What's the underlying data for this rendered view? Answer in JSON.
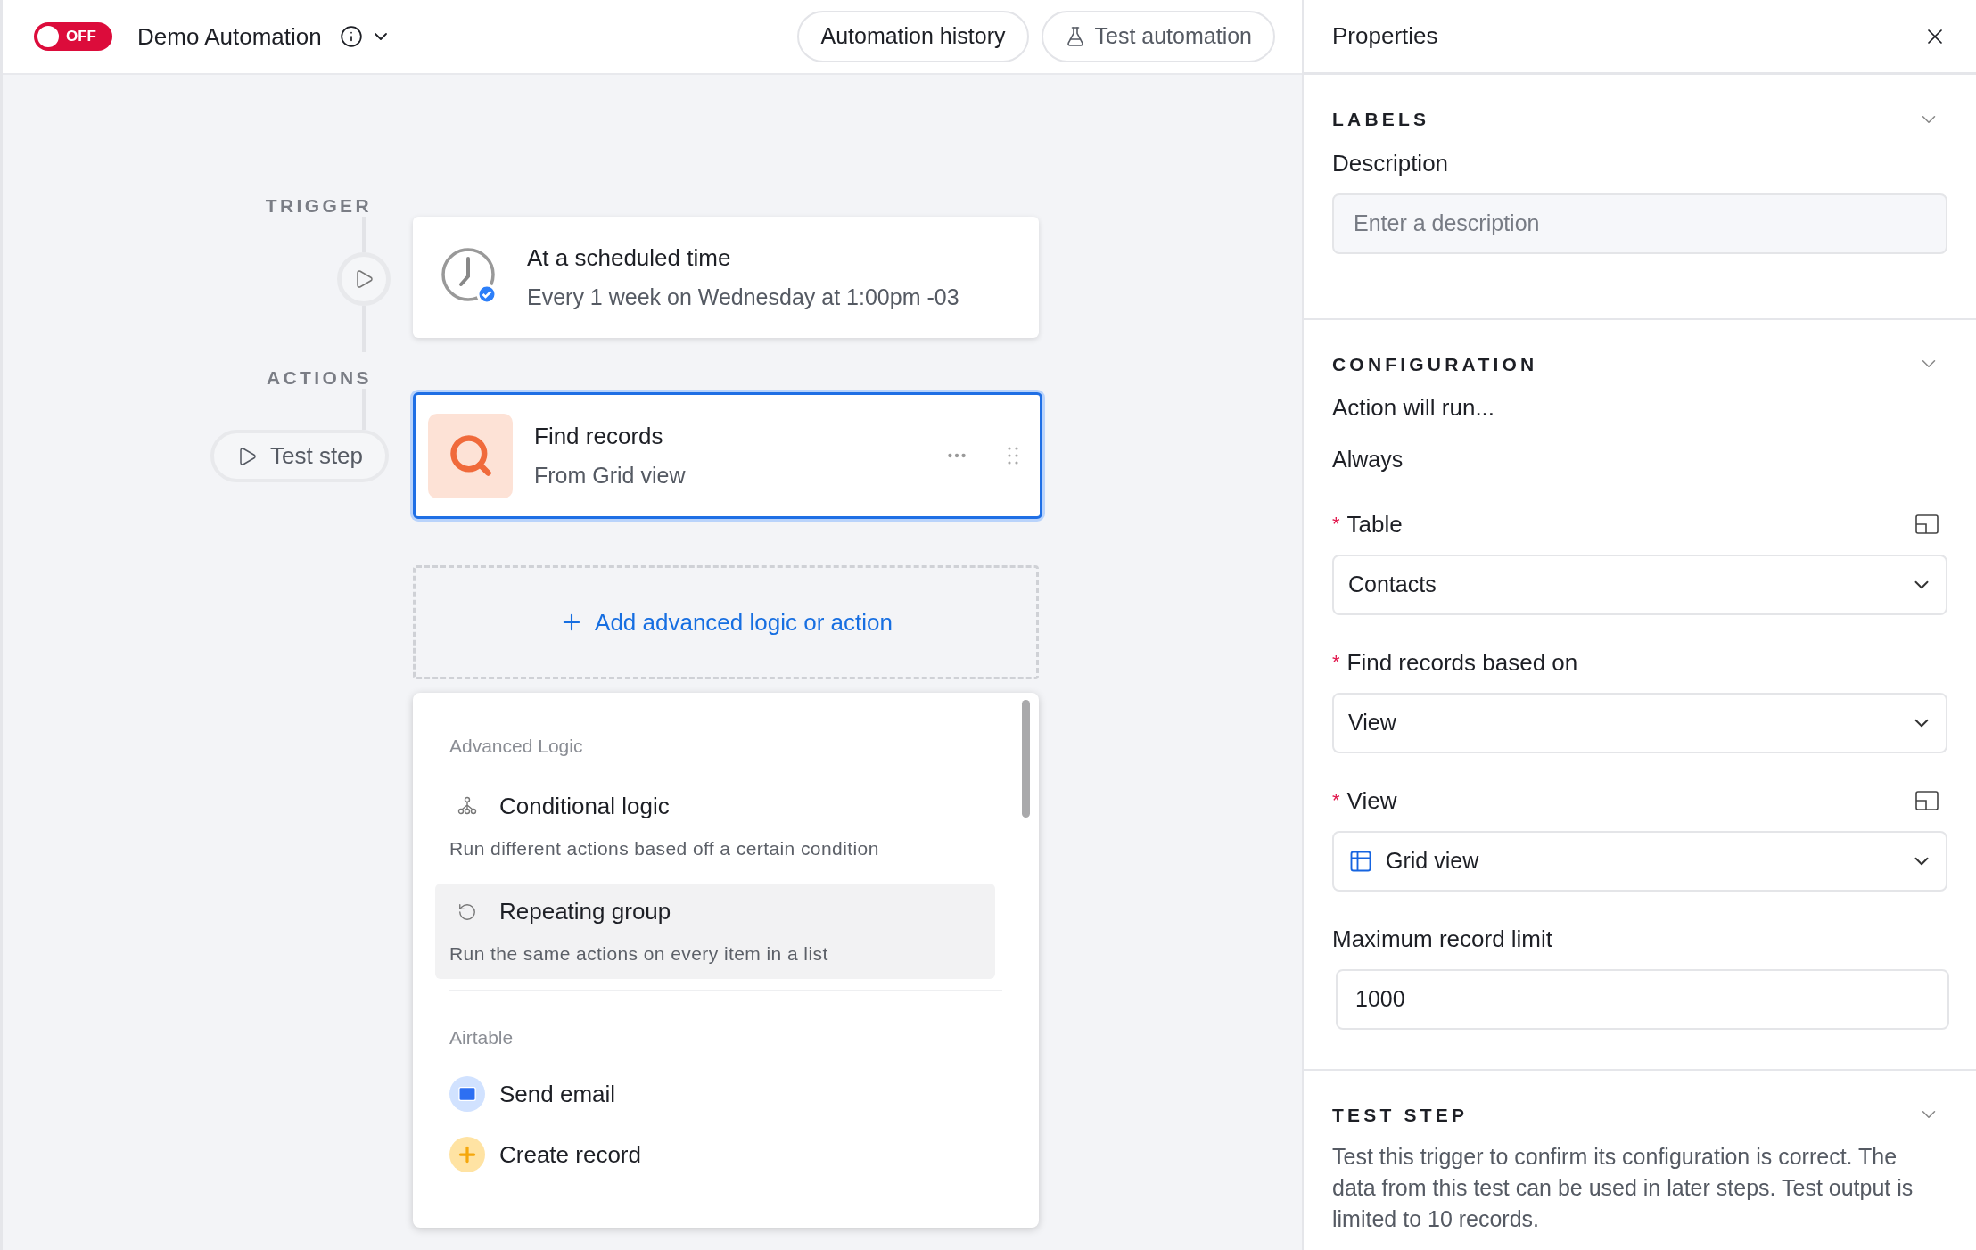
{
  "header": {
    "toggle": {
      "label": "OFF",
      "on": false
    },
    "title": "Demo Automation",
    "buttons": [
      {
        "kind": "plain",
        "label": "Automation history"
      },
      {
        "kind": "flask",
        "label": "Test automation"
      }
    ]
  },
  "canvas": {
    "trigger": {
      "section_label": "TRIGGER",
      "title": "At a scheduled time",
      "subtitle": "Every 1 week on Wednesday at 1:00pm -03"
    },
    "actions": {
      "section_label": "ACTIONS",
      "test_step": "Test step",
      "card": {
        "title": "Find records",
        "subtitle": "From Grid view",
        "selected": true
      }
    },
    "add_button": "Add advanced logic or action",
    "menu": {
      "groups": [
        {
          "heading": "Advanced Logic",
          "items": [
            {
              "kind": "branch",
              "title": "Conditional logic",
              "description": "Run different actions based off a certain condition",
              "selected": false
            },
            {
              "kind": "repeat",
              "title": "Repeating group",
              "description": "Run the same actions on every item in a list",
              "selected": true
            }
          ]
        },
        {
          "heading": "Airtable",
          "items": [
            {
              "kind": "email",
              "title": "Send email",
              "selected": false
            },
            {
              "kind": "create",
              "title": "Create record",
              "selected": false
            }
          ]
        }
      ]
    }
  },
  "properties": {
    "title": "Properties",
    "sections": [
      {
        "heading": "LABELS",
        "fields": [
          {
            "kind": "text",
            "label": "Description",
            "placeholder": "Enter a description",
            "expand_icon": false
          }
        ]
      },
      {
        "heading": "CONFIGURATION",
        "fields": [
          {
            "kind": "static",
            "label": "Action will run...",
            "value": "Always"
          },
          {
            "kind": "select",
            "label": "Table",
            "value": "Contacts",
            "required_mark": "*",
            "expand_icon": true
          },
          {
            "kind": "select",
            "label": "Find records based on",
            "value": "View",
            "required_mark": "*",
            "expand_icon": false
          },
          {
            "kind": "grid_select",
            "label": "View",
            "value": "Grid view",
            "required_mark": "*",
            "expand_icon": true
          },
          {
            "kind": "number",
            "label": "Maximum record limit",
            "value": "1000",
            "expand_icon": false
          }
        ]
      },
      {
        "heading": "TEST STEP",
        "text": "Test this trigger to confirm its configuration is correct. The data from this test can be used in later steps. Test output is limited to 10 records."
      }
    ]
  }
}
